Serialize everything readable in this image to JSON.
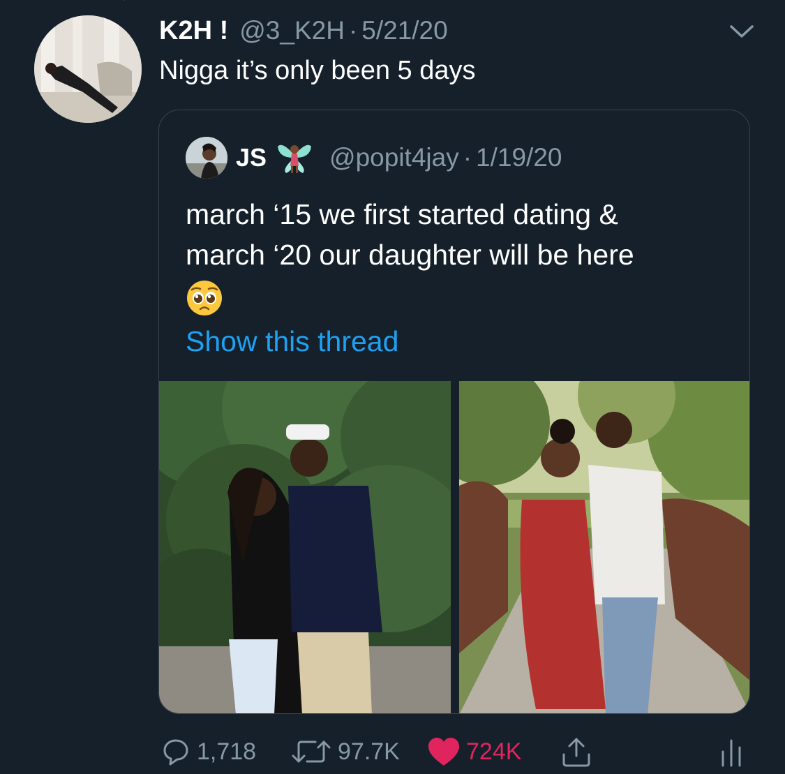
{
  "tweet": {
    "display_name": "K2H !",
    "handle": "@3_K2H",
    "separator": "·",
    "date": "5/21/20",
    "text": "Nigga it’s only been 5 days"
  },
  "quoted": {
    "display_name": "JS",
    "name_emoji": "fairy-emoji",
    "handle": "@popit4jay",
    "separator": "·",
    "date": "1/19/20",
    "text_line1": "march ‘15 we first started dating &",
    "text_line2": "march ‘20 our daughter will be here",
    "text_emoji": "pleading-face-emoji",
    "show_thread": "Show this thread"
  },
  "actions": {
    "replies": "1,718",
    "retweets": "97.7K",
    "likes": "724K",
    "liked": true,
    "like_color": "#e0245e"
  },
  "colors": {
    "background": "#15202b",
    "muted": "#8899a6",
    "link": "#1da1f2",
    "border": "#38444d"
  }
}
